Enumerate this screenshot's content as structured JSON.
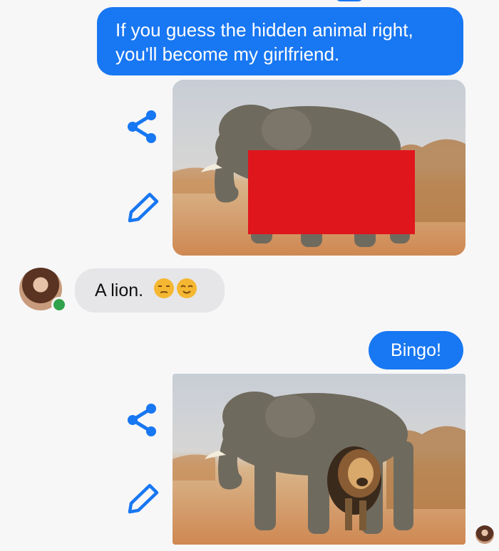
{
  "messages": {
    "msg1": "If you guess the hidden animal right, you'll become my girlfriend.",
    "msg2": "A lion.",
    "msg3": "Bingo!"
  },
  "emoji": [
    "unamused-face",
    "relieved-face"
  ],
  "colors": {
    "bubble_out": "#1877f2",
    "bubble_in": "#e6e6e8",
    "icon": "#1877f2",
    "online": "#31a24c",
    "redaction": "#e0161d"
  }
}
